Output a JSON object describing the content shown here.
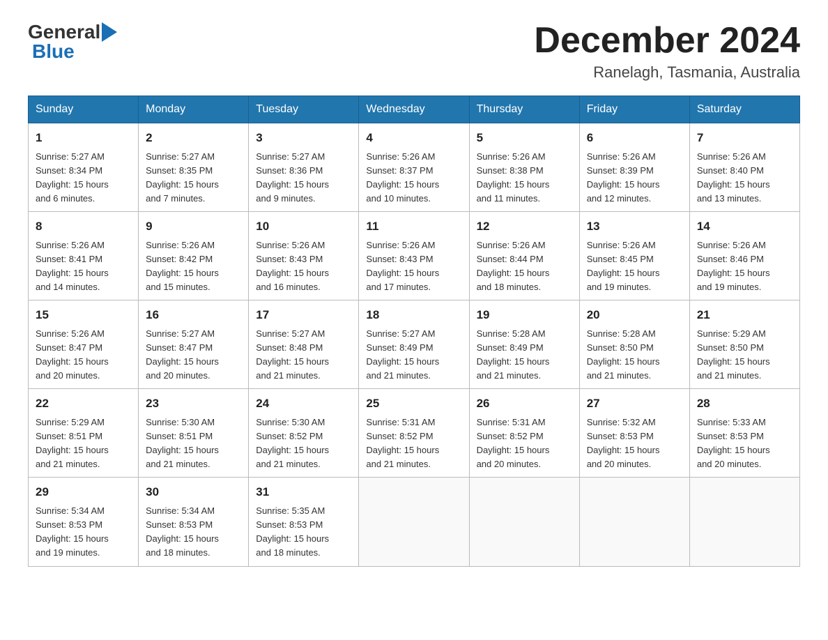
{
  "logo": {
    "general": "General",
    "blue": "Blue"
  },
  "title": {
    "month": "December 2024",
    "location": "Ranelagh, Tasmania, Australia"
  },
  "days_of_week": [
    "Sunday",
    "Monday",
    "Tuesday",
    "Wednesday",
    "Thursday",
    "Friday",
    "Saturday"
  ],
  "weeks": [
    [
      {
        "day": "1",
        "sunrise": "5:27 AM",
        "sunset": "8:34 PM",
        "daylight": "15 hours and 6 minutes."
      },
      {
        "day": "2",
        "sunrise": "5:27 AM",
        "sunset": "8:35 PM",
        "daylight": "15 hours and 7 minutes."
      },
      {
        "day": "3",
        "sunrise": "5:27 AM",
        "sunset": "8:36 PM",
        "daylight": "15 hours and 9 minutes."
      },
      {
        "day": "4",
        "sunrise": "5:26 AM",
        "sunset": "8:37 PM",
        "daylight": "15 hours and 10 minutes."
      },
      {
        "day": "5",
        "sunrise": "5:26 AM",
        "sunset": "8:38 PM",
        "daylight": "15 hours and 11 minutes."
      },
      {
        "day": "6",
        "sunrise": "5:26 AM",
        "sunset": "8:39 PM",
        "daylight": "15 hours and 12 minutes."
      },
      {
        "day": "7",
        "sunrise": "5:26 AM",
        "sunset": "8:40 PM",
        "daylight": "15 hours and 13 minutes."
      }
    ],
    [
      {
        "day": "8",
        "sunrise": "5:26 AM",
        "sunset": "8:41 PM",
        "daylight": "15 hours and 14 minutes."
      },
      {
        "day": "9",
        "sunrise": "5:26 AM",
        "sunset": "8:42 PM",
        "daylight": "15 hours and 15 minutes."
      },
      {
        "day": "10",
        "sunrise": "5:26 AM",
        "sunset": "8:43 PM",
        "daylight": "15 hours and 16 minutes."
      },
      {
        "day": "11",
        "sunrise": "5:26 AM",
        "sunset": "8:43 PM",
        "daylight": "15 hours and 17 minutes."
      },
      {
        "day": "12",
        "sunrise": "5:26 AM",
        "sunset": "8:44 PM",
        "daylight": "15 hours and 18 minutes."
      },
      {
        "day": "13",
        "sunrise": "5:26 AM",
        "sunset": "8:45 PM",
        "daylight": "15 hours and 19 minutes."
      },
      {
        "day": "14",
        "sunrise": "5:26 AM",
        "sunset": "8:46 PM",
        "daylight": "15 hours and 19 minutes."
      }
    ],
    [
      {
        "day": "15",
        "sunrise": "5:26 AM",
        "sunset": "8:47 PM",
        "daylight": "15 hours and 20 minutes."
      },
      {
        "day": "16",
        "sunrise": "5:27 AM",
        "sunset": "8:47 PM",
        "daylight": "15 hours and 20 minutes."
      },
      {
        "day": "17",
        "sunrise": "5:27 AM",
        "sunset": "8:48 PM",
        "daylight": "15 hours and 21 minutes."
      },
      {
        "day": "18",
        "sunrise": "5:27 AM",
        "sunset": "8:49 PM",
        "daylight": "15 hours and 21 minutes."
      },
      {
        "day": "19",
        "sunrise": "5:28 AM",
        "sunset": "8:49 PM",
        "daylight": "15 hours and 21 minutes."
      },
      {
        "day": "20",
        "sunrise": "5:28 AM",
        "sunset": "8:50 PM",
        "daylight": "15 hours and 21 minutes."
      },
      {
        "day": "21",
        "sunrise": "5:29 AM",
        "sunset": "8:50 PM",
        "daylight": "15 hours and 21 minutes."
      }
    ],
    [
      {
        "day": "22",
        "sunrise": "5:29 AM",
        "sunset": "8:51 PM",
        "daylight": "15 hours and 21 minutes."
      },
      {
        "day": "23",
        "sunrise": "5:30 AM",
        "sunset": "8:51 PM",
        "daylight": "15 hours and 21 minutes."
      },
      {
        "day": "24",
        "sunrise": "5:30 AM",
        "sunset": "8:52 PM",
        "daylight": "15 hours and 21 minutes."
      },
      {
        "day": "25",
        "sunrise": "5:31 AM",
        "sunset": "8:52 PM",
        "daylight": "15 hours and 21 minutes."
      },
      {
        "day": "26",
        "sunrise": "5:31 AM",
        "sunset": "8:52 PM",
        "daylight": "15 hours and 20 minutes."
      },
      {
        "day": "27",
        "sunrise": "5:32 AM",
        "sunset": "8:53 PM",
        "daylight": "15 hours and 20 minutes."
      },
      {
        "day": "28",
        "sunrise": "5:33 AM",
        "sunset": "8:53 PM",
        "daylight": "15 hours and 20 minutes."
      }
    ],
    [
      {
        "day": "29",
        "sunrise": "5:34 AM",
        "sunset": "8:53 PM",
        "daylight": "15 hours and 19 minutes."
      },
      {
        "day": "30",
        "sunrise": "5:34 AM",
        "sunset": "8:53 PM",
        "daylight": "15 hours and 18 minutes."
      },
      {
        "day": "31",
        "sunrise": "5:35 AM",
        "sunset": "8:53 PM",
        "daylight": "15 hours and 18 minutes."
      },
      null,
      null,
      null,
      null
    ]
  ]
}
